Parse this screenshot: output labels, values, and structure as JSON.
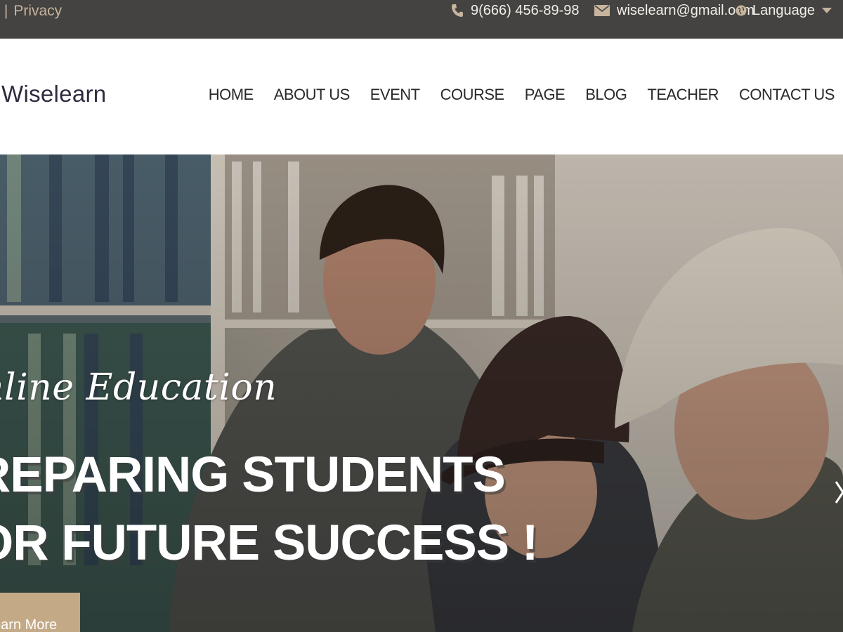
{
  "topbar": {
    "links": [
      ":",
      "|",
      "Privacy"
    ],
    "phone": "9(666) 456-89-98",
    "email": "wiselearn@gmail.ocm",
    "language": "Language",
    "icons": {
      "phone": "phone-icon",
      "email": "envelope-icon",
      "language": "globe-icon",
      "caret": "caret-down-icon"
    }
  },
  "header": {
    "brand": "Wiselearn",
    "nav": [
      "HOME",
      "ABOUT US",
      "EVENT",
      "COURSE",
      "PAGE",
      "BLOG",
      "TEACHER",
      "CONTACT US"
    ]
  },
  "hero": {
    "subtitle": "nline Education",
    "title_line1": "REPARING STUDENTS",
    "title_line2": "OR FUTURE SUCCESS !",
    "cta": "earn More"
  },
  "colors": {
    "topbar_bg": "#444341",
    "accent": "#c4a986",
    "nav_text": "#2a2a2a",
    "brand_text": "#2e2a3f"
  }
}
